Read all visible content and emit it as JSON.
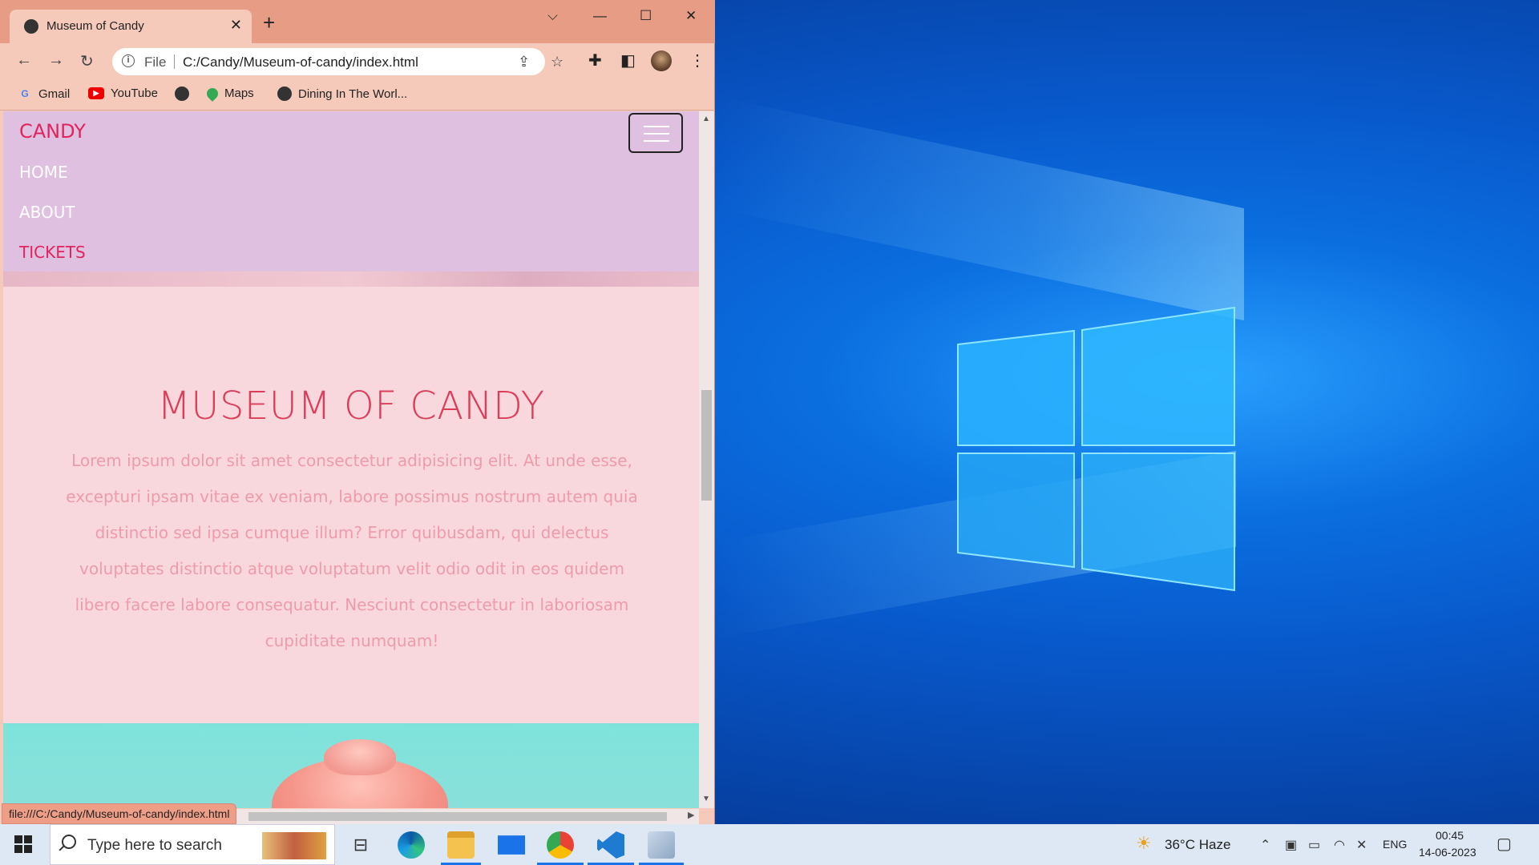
{
  "browser": {
    "tab_title": "Museum of Candy",
    "tab_close": "✕",
    "new_tab": "+",
    "window_controls": {
      "dropdown": "⌵",
      "minimize": "—",
      "maximize": "☐",
      "close": "✕"
    },
    "nav": {
      "back": "←",
      "forward": "→",
      "reload": "↻"
    },
    "omnibox": {
      "info": "i",
      "scheme_label": "File",
      "url": "C:/Candy/Museum-of-candy/index.html"
    },
    "bookmarks": [
      {
        "label": "Gmail",
        "icon": "google-icon"
      },
      {
        "label": "YouTube",
        "icon": "youtube-icon"
      },
      {
        "label": "",
        "icon": "globe-icon"
      },
      {
        "label": "Maps",
        "icon": "maps-icon"
      },
      {
        "label": "Dining In The Worl...",
        "icon": "globe-icon"
      }
    ],
    "status_url": "file:///C:/Candy/Museum-of-candy/index.html"
  },
  "page": {
    "brand": "CANDY",
    "nav_links": [
      "HOME",
      "ABOUT",
      "TICKETS"
    ],
    "hero_title": "MUSEUM OF CANDY",
    "hero_text": "Lorem ipsum dolor sit amet consectetur adipisicing elit. At unde esse, excepturi ipsam vitae ex veniam, labore possimus nostrum autem quia distinctio sed ipsa cumque illum? Error quibusdam, qui delectus voluptates distinctio atque voluptatum velit odio odit in eos quidem libero facere labore consequatur. Nesciunt consectetur in laboriosam cupiditate numquam!"
  },
  "taskbar": {
    "search_placeholder": "Type here to search",
    "weather": "36°C  Haze",
    "language": "ENG",
    "time": "00:45",
    "date": "14-06-2023"
  },
  "colors": {
    "accent_pink": "#e0245e",
    "nav_bg": "#e0c0e0",
    "page_bg": "#f8d7dd",
    "browser_frame": "#e79d85"
  }
}
